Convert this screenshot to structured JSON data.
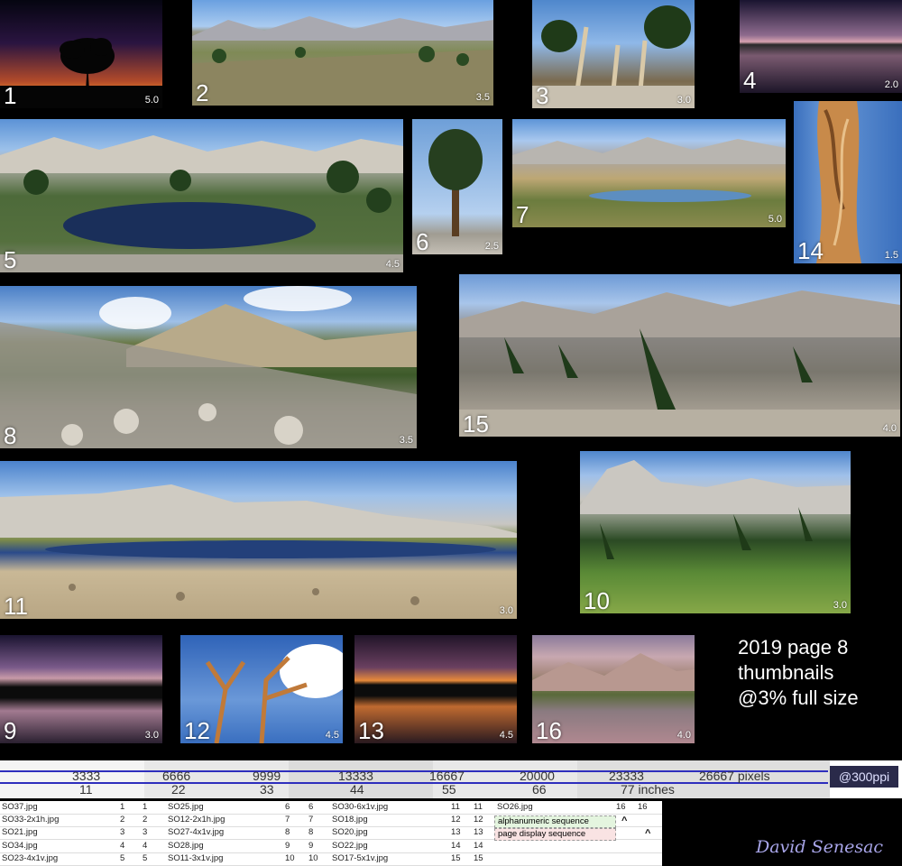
{
  "thumbnails": [
    {
      "num": "1",
      "size": "5.0",
      "scene": "sunset-tree-silhouette"
    },
    {
      "num": "2",
      "size": "3.5",
      "scene": "mountain-meadow-panorama"
    },
    {
      "num": "3",
      "size": "3.0",
      "scene": "bristlecone-pines"
    },
    {
      "num": "4",
      "size": "2.0",
      "scene": "dusk-lake-reflection"
    },
    {
      "num": "5",
      "size": "4.5",
      "scene": "alpine-lake-panorama"
    },
    {
      "num": "6",
      "size": "2.5",
      "scene": "lone-pine-tree"
    },
    {
      "num": "7",
      "size": "5.0",
      "scene": "meadow-pond"
    },
    {
      "num": "14",
      "size": "1.5",
      "scene": "twisted-trunk"
    },
    {
      "num": "8",
      "size": "3.5",
      "scene": "rocky-slope-clouds"
    },
    {
      "num": "15",
      "size": "4.0",
      "scene": "pines-ridge"
    },
    {
      "num": "11",
      "size": "3.0",
      "scene": "lake-and-granite-peaks"
    },
    {
      "num": "10",
      "size": "3.0",
      "scene": "green-meadow-peaks"
    },
    {
      "num": "9",
      "size": "3.0",
      "scene": "twilight-reflection"
    },
    {
      "num": "12",
      "size": "4.5",
      "scene": "dead-tree-clouds"
    },
    {
      "num": "13",
      "size": "4.5",
      "scene": "sunset-lake"
    },
    {
      "num": "16",
      "size": "4.0",
      "scene": "pink-peaks-reflection"
    }
  ],
  "info": {
    "line1": "2019 page 8",
    "line2": "thumbnails",
    "line3": "@3% full size"
  },
  "ruler": {
    "pixels": [
      "3333",
      "6666",
      "9999",
      "13333",
      "16667",
      "20000",
      "23333",
      "26667 pixels"
    ],
    "inches": [
      "11",
      "22",
      "33",
      "44",
      "55",
      "66",
      "77 inches"
    ],
    "dpi": "@300ppi"
  },
  "files": {
    "rows": [
      [
        "SO37.jpg",
        "1",
        "1",
        "SO25.jpg",
        "6",
        "6",
        "SO30-6x1v.jpg",
        "11",
        "11",
        "SO26.jpg",
        "16",
        "16"
      ],
      [
        "SO33-2x1h.jpg",
        "2",
        "2",
        "SO12-2x1h.jpg",
        "7",
        "7",
        "SO18.jpg",
        "12",
        "12",
        "",
        "",
        ""
      ],
      [
        "SO21.jpg",
        "3",
        "3",
        "SO27-4x1v.jpg",
        "8",
        "8",
        "SO20.jpg",
        "13",
        "13",
        "",
        "",
        ""
      ],
      [
        "SO34.jpg",
        "4",
        "4",
        "SO28.jpg",
        "9",
        "9",
        "SO22.jpg",
        "14",
        "14",
        "",
        "",
        ""
      ],
      [
        "SO23-4x1v.jpg",
        "5",
        "5",
        "SO11-3x1v.jpg",
        "10",
        "10",
        "SO17-5x1v.jpg",
        "15",
        "15",
        "",
        "",
        ""
      ]
    ],
    "legend_alpha": "alphanumeric sequence",
    "legend_page": "page display sequence",
    "caret": "^"
  },
  "signature": "David Senesac"
}
